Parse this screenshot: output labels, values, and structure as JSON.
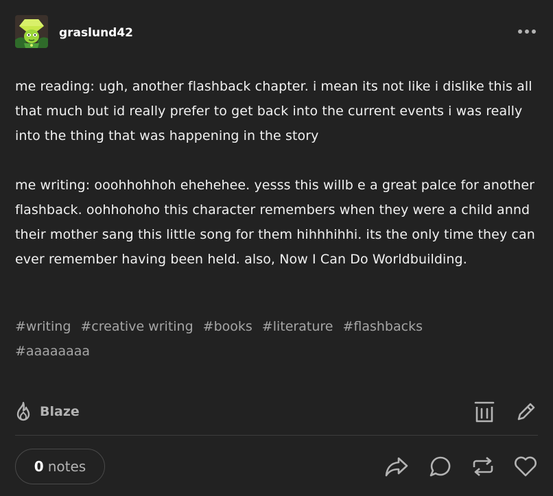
{
  "post": {
    "author": {
      "username": "graslund42"
    },
    "more_icon": "ellipsis-icon",
    "paragraphs": [
      "me reading: ugh, another flashback chapter. i mean its not like i dislike this all that much but id really prefer to get back into the current events i was really into the thing that was happening in the story",
      "me writing: ooohhohhoh ehehehee. yesss this willb e a great palce for another flashback. oohhohoho this character remembers when they were a child annd their mother sang this little song for them hihhhihhi. its the only time they can ever remember having been held. also, Now I Can Do Worldbuilding."
    ],
    "tags": [
      "#writing",
      "#creative writing",
      "#books",
      "#literature",
      "#flashbacks",
      "#aaaaaaaa"
    ]
  },
  "actions": {
    "blaze_label": "Blaze",
    "blaze_icon": "flame-icon",
    "delete_icon": "trash-icon",
    "edit_icon": "pencil-icon"
  },
  "footer": {
    "notes_count": "0",
    "notes_label": "notes",
    "icons": [
      "share-icon",
      "reply-icon",
      "reblog-icon",
      "heart-icon"
    ]
  },
  "colors": {
    "background": "#222222",
    "text": "#f1f1f1",
    "muted": "#a6a6a6",
    "divider": "#3d3d3d"
  }
}
